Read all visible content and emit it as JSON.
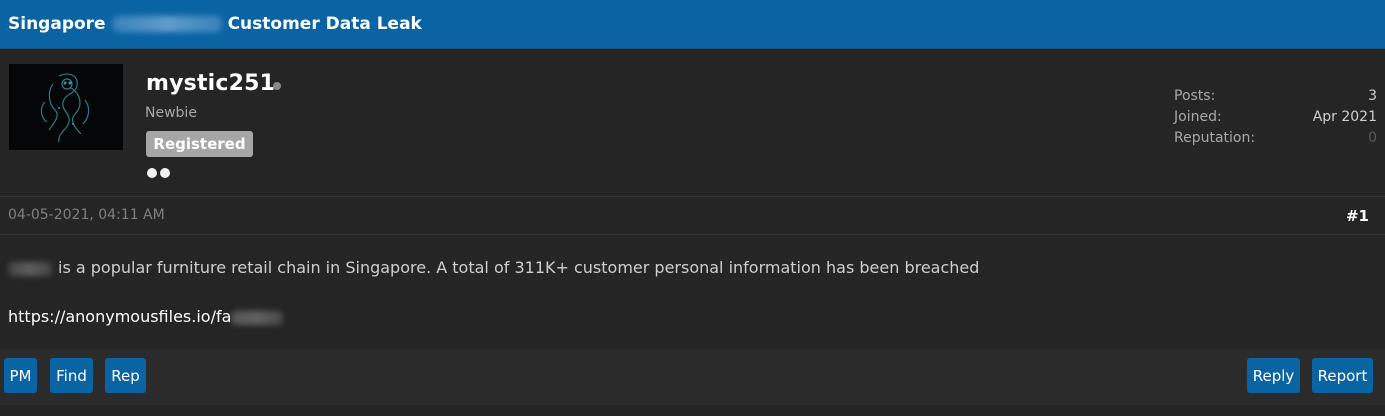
{
  "thread": {
    "title_prefix": "Singapore",
    "title_suffix": "Customer Data Leak"
  },
  "author": {
    "username": "mystic251",
    "user_title": "Newbie",
    "group_badge": "Registered",
    "star_count": 2,
    "online_status": "offline",
    "avatar_icon": "dark-skull-dragon-avatar"
  },
  "stats": {
    "posts_label": "Posts:",
    "posts_value": "3",
    "joined_label": "Joined:",
    "joined_value": "Apr 2021",
    "reputation_label": "Reputation:",
    "reputation_value": "0"
  },
  "post": {
    "date": "04-05-2021, 04:11 AM",
    "number": "#1",
    "message": "is a popular furniture retail chain in Singapore. A total of 311K+ customer personal information has been breached",
    "link": "https://anonymousfiles.io/fa"
  },
  "buttons": {
    "pm": "PM",
    "find": "Find",
    "rep": "Rep",
    "reply": "Reply",
    "report": "Report"
  },
  "colors": {
    "header_bg": "#0a64a4",
    "post_bg": "#252525",
    "page_bg": "#2b2b2b",
    "button_bg": "#0a64a4",
    "badge_bg": "#a6a6a6"
  }
}
